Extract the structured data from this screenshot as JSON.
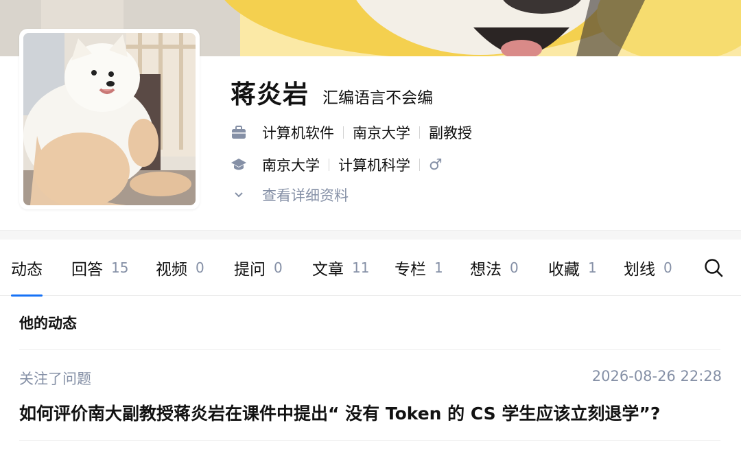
{
  "profile": {
    "name": "蒋炎岩",
    "headline": "汇编语言不会编",
    "work": [
      "计算机软件",
      "南京大学",
      "副教授"
    ],
    "education": [
      "南京大学",
      "计算机科学"
    ],
    "gender_symbol": "♂",
    "details_link": "查看详细资料"
  },
  "icons": {
    "work": "briefcase-icon",
    "education": "graduation-cap-icon",
    "details": "chevron-down-icon",
    "search": "search-icon"
  },
  "tabs": [
    {
      "label": "动态",
      "count": ""
    },
    {
      "label": "回答",
      "count": "15"
    },
    {
      "label": "视频",
      "count": "0"
    },
    {
      "label": "提问",
      "count": "0"
    },
    {
      "label": "文章",
      "count": "11"
    },
    {
      "label": "专栏",
      "count": "1"
    },
    {
      "label": "想法",
      "count": "0"
    },
    {
      "label": "收藏",
      "count": "1"
    },
    {
      "label": "划线",
      "count": "0"
    }
  ],
  "active_tab": "动态",
  "feed": {
    "title": "他的动态",
    "items": [
      {
        "action": "关注了问题",
        "time": "2026-08-26 22:28",
        "question": "如何评价南大副教授蒋炎岩在课件中提出“ 没有 Token 的 CS 学生应该立刻退学”?"
      }
    ]
  },
  "colors": {
    "accent": "#1772f6",
    "muted": "#8590a6",
    "text": "#121212",
    "cover_yellow": "#f5d35a"
  }
}
